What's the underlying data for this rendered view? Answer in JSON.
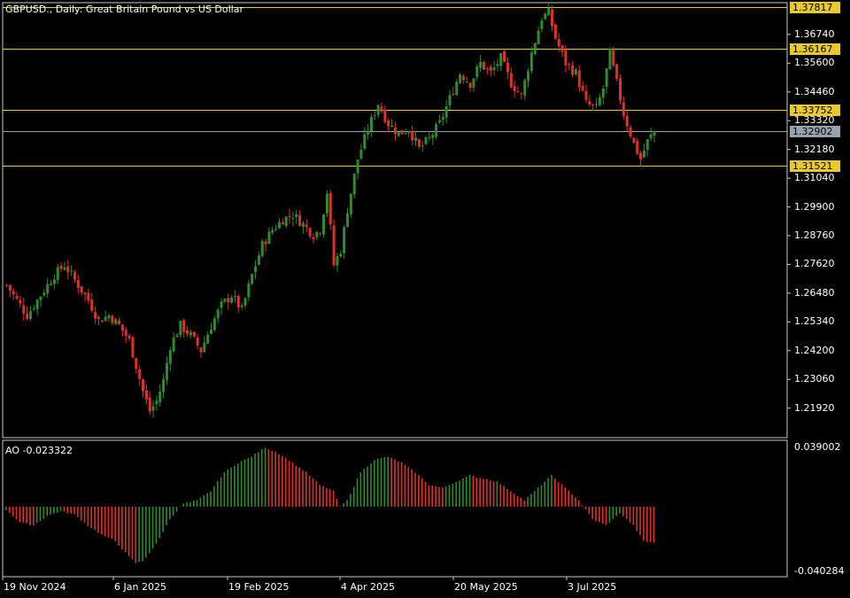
{
  "main": {
    "symbol_title": "GBPUSD., Daily:  Great Britain Pound vs US Dollar",
    "price_ticks": [
      "1.36740",
      "1.35600",
      "1.34460",
      "1.33320",
      "1.32180",
      "1.31040",
      "1.29900",
      "1.28760",
      "1.27620",
      "1.26480",
      "1.25340",
      "1.24200",
      "1.23060",
      "1.21920"
    ],
    "price_range": [
      1.2075,
      1.38
    ],
    "levels": [
      {
        "label": "1.37817",
        "value": 1.37817,
        "color": "#e8c930"
      },
      {
        "label": "1.36167",
        "value": 1.36167,
        "color": "#e8c930"
      },
      {
        "label": "1.33752",
        "value": 1.33752,
        "color": "#e8c930"
      },
      {
        "label": "1.31521",
        "value": 1.31521,
        "color": "#e8c930"
      }
    ],
    "current_price": {
      "label": "1.32902",
      "value": 1.32902,
      "color": "#9aa3ad"
    },
    "candle_colors": {
      "up": "#2e8b2e",
      "down": "#e0302a"
    }
  },
  "ao": {
    "label": "AO -0.023322",
    "top_label": "0.039002",
    "bottom_label": "-0.040284",
    "range": [
      -0.040284,
      0.039002
    ],
    "up_color": "#2e8b2e",
    "down_color": "#e0302a"
  },
  "dates": [
    "19 Nov 2024",
    "6 Jan 2025",
    "19 Feb 2025",
    "4 Apr 2025",
    "20 May 2025",
    "3 Jul 2025"
  ],
  "chart_data": {
    "type": "candlestick",
    "title": "GBPUSD., Daily:  Great Britain Pound vs US Dollar",
    "y_ticks": [
      "1.36740",
      "1.35600",
      "1.34460",
      "1.33320",
      "1.32180",
      "1.31040",
      "1.29900",
      "1.28760",
      "1.27620",
      "1.26480",
      "1.25340",
      "1.24200",
      "1.23060",
      "1.21920"
    ],
    "close_path": [
      [
        0,
        1.268
      ],
      [
        3,
        1.262
      ],
      [
        6,
        1.256
      ],
      [
        10,
        1.264
      ],
      [
        14,
        1.272
      ],
      [
        17,
        1.276
      ],
      [
        20,
        1.27
      ],
      [
        24,
        1.262
      ],
      [
        27,
        1.254
      ],
      [
        30,
        1.256
      ],
      [
        33,
        1.252
      ],
      [
        36,
        1.246
      ],
      [
        38,
        1.236
      ],
      [
        40,
        1.226
      ],
      [
        42,
        1.218
      ],
      [
        44,
        1.222
      ],
      [
        46,
        1.23
      ],
      [
        48,
        1.244
      ],
      [
        51,
        1.252
      ],
      [
        54,
        1.248
      ],
      [
        57,
        1.242
      ],
      [
        60,
        1.252
      ],
      [
        63,
        1.26
      ],
      [
        66,
        1.264
      ],
      [
        69,
        1.258
      ],
      [
        72,
        1.272
      ],
      [
        75,
        1.284
      ],
      [
        78,
        1.29
      ],
      [
        81,
        1.294
      ],
      [
        84,
        1.296
      ],
      [
        87,
        1.292
      ],
      [
        90,
        1.288
      ],
      [
        92,
        1.29
      ],
      [
        94,
        1.305
      ],
      [
        96,
        1.276
      ],
      [
        98,
        1.282
      ],
      [
        100,
        1.298
      ],
      [
        103,
        1.318
      ],
      [
        106,
        1.33
      ],
      [
        109,
        1.34
      ],
      [
        112,
        1.332
      ],
      [
        115,
        1.328
      ],
      [
        118,
        1.33
      ],
      [
        121,
        1.322
      ],
      [
        124,
        1.326
      ],
      [
        127,
        1.332
      ],
      [
        130,
        1.342
      ],
      [
        133,
        1.352
      ],
      [
        136,
        1.348
      ],
      [
        139,
        1.356
      ],
      [
        142,
        1.352
      ],
      [
        145,
        1.358
      ],
      [
        148,
        1.348
      ],
      [
        151,
        1.343
      ],
      [
        154,
        1.36
      ],
      [
        157,
        1.374
      ],
      [
        159,
        1.376
      ],
      [
        161,
        1.366
      ],
      [
        164,
        1.356
      ],
      [
        167,
        1.352
      ],
      [
        170,
        1.34
      ],
      [
        173,
        1.338
      ],
      [
        175,
        1.346
      ],
      [
        177,
        1.36
      ],
      [
        179,
        1.348
      ],
      [
        181,
        1.336
      ],
      [
        184,
        1.324
      ],
      [
        186,
        1.318
      ],
      [
        188,
        1.325
      ],
      [
        190,
        1.329
      ]
    ],
    "ao_path": [
      [
        0,
        -0.002
      ],
      [
        4,
        -0.01
      ],
      [
        8,
        -0.012
      ],
      [
        12,
        -0.006
      ],
      [
        16,
        -0.003
      ],
      [
        20,
        -0.005
      ],
      [
        24,
        -0.012
      ],
      [
        28,
        -0.018
      ],
      [
        32,
        -0.022
      ],
      [
        36,
        -0.032
      ],
      [
        38,
        -0.036
      ],
      [
        40,
        -0.035
      ],
      [
        44,
        -0.024
      ],
      [
        48,
        -0.008
      ],
      [
        52,
        0.002
      ],
      [
        56,
        0.004
      ],
      [
        60,
        0.01
      ],
      [
        64,
        0.022
      ],
      [
        68,
        0.028
      ],
      [
        72,
        0.032
      ],
      [
        76,
        0.038
      ],
      [
        80,
        0.034
      ],
      [
        84,
        0.028
      ],
      [
        88,
        0.022
      ],
      [
        92,
        0.014
      ],
      [
        96,
        0.01
      ],
      [
        98,
        0.0
      ],
      [
        100,
        0.004
      ],
      [
        104,
        0.022
      ],
      [
        108,
        0.03
      ],
      [
        112,
        0.032
      ],
      [
        116,
        0.028
      ],
      [
        120,
        0.022
      ],
      [
        124,
        0.014
      ],
      [
        128,
        0.012
      ],
      [
        132,
        0.016
      ],
      [
        136,
        0.02
      ],
      [
        140,
        0.018
      ],
      [
        144,
        0.016
      ],
      [
        148,
        0.01
      ],
      [
        152,
        0.004
      ],
      [
        156,
        0.012
      ],
      [
        160,
        0.02
      ],
      [
        164,
        0.012
      ],
      [
        168,
        0.004
      ],
      [
        172,
        -0.008
      ],
      [
        176,
        -0.012
      ],
      [
        180,
        -0.004
      ],
      [
        184,
        -0.012
      ],
      [
        187,
        -0.022
      ],
      [
        190,
        -0.023
      ]
    ]
  }
}
